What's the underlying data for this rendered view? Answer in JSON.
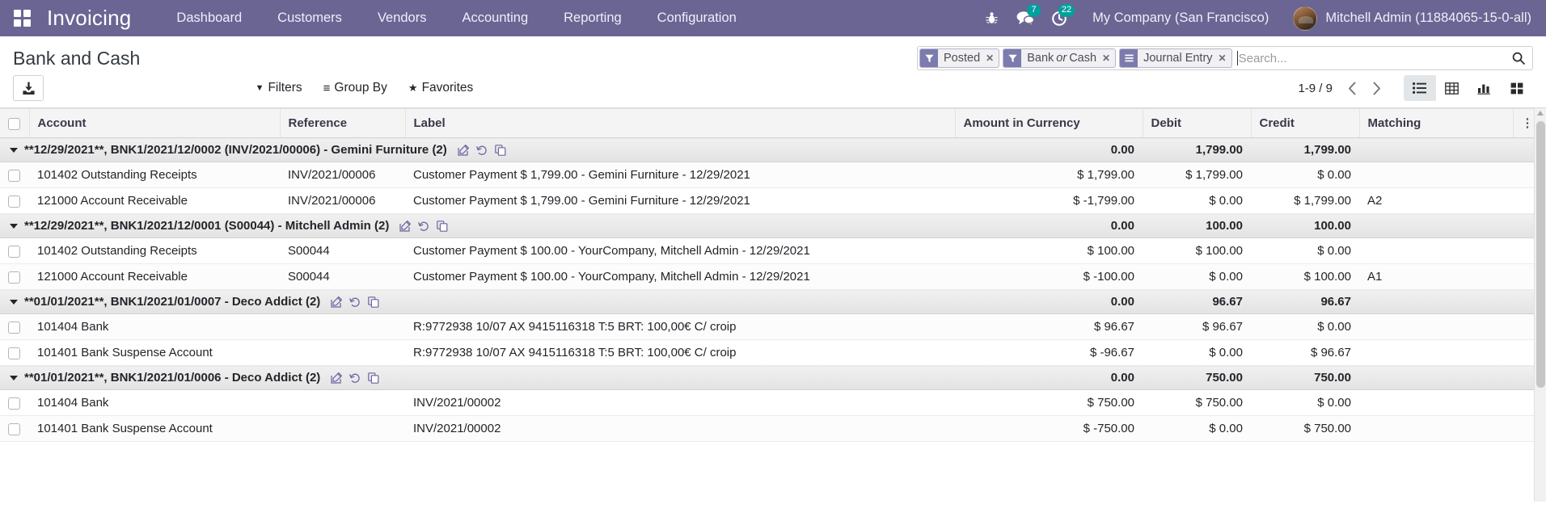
{
  "navbar": {
    "apps_icon": "apps-grid-icon",
    "brand": "Invoicing",
    "menu": [
      {
        "label": "Dashboard"
      },
      {
        "label": "Customers"
      },
      {
        "label": "Vendors"
      },
      {
        "label": "Accounting"
      },
      {
        "label": "Reporting"
      },
      {
        "label": "Configuration"
      }
    ],
    "sys_icons": [
      {
        "name": "bug-icon",
        "glyph": "☣",
        "badge": null
      },
      {
        "name": "messages-icon",
        "glyph": "💬",
        "badge": "7"
      },
      {
        "name": "activities-icon",
        "glyph": "◔",
        "badge": "22"
      }
    ],
    "company": "My Company (San Francisco)",
    "user": "Mitchell Admin (11884065-15-0-all)"
  },
  "control_panel": {
    "title": "Bank and Cash",
    "export_icon": "download-icon",
    "facets": [
      {
        "icon": "filter-icon",
        "label": "Posted",
        "remove": "✕"
      },
      {
        "icon": "filter-icon",
        "label_pre": "Bank ",
        "label_em": "or",
        "label_post": " Cash",
        "label": "Bank or Cash",
        "remove": "✕"
      },
      {
        "icon": "group-icon",
        "label": "Journal Entry",
        "remove": "✕"
      }
    ],
    "search_value": "",
    "search_placeholder": "Search...",
    "search_icon": "search-icon",
    "buttons": [
      {
        "name": "filters-dropdown",
        "icon": "filter-caret-icon",
        "glyph": "▼",
        "label": "Filters"
      },
      {
        "name": "groupby-dropdown",
        "icon": "hamburger-icon",
        "glyph": "≡",
        "label": "Group By"
      },
      {
        "name": "favorites-dropdown",
        "icon": "star-icon",
        "glyph": "★",
        "label": "Favorites"
      }
    ],
    "pager": "1-9 / 9",
    "prev_icon": "chevron-left-icon",
    "next_icon": "chevron-right-icon",
    "views": [
      {
        "name": "list-view-button",
        "icon": "list-icon",
        "active": true
      },
      {
        "name": "pivot-view-button",
        "icon": "table-icon",
        "active": false
      },
      {
        "name": "graph-view-button",
        "icon": "bar-chart-icon",
        "active": false
      },
      {
        "name": "kanban-view-button",
        "icon": "kanban-icon",
        "active": false
      }
    ]
  },
  "table": {
    "columns": [
      "Account",
      "Reference",
      "Label",
      "Amount in Currency",
      "Debit",
      "Credit",
      "Matching"
    ],
    "optional_icon": "vertical-dots-icon",
    "group_actions": [
      "edit-icon",
      "revert-icon",
      "duplicate-icon"
    ],
    "groups": [
      {
        "title": "**12/29/2021**, BNK1/2021/12/0002 (INV/2021/00006) - Gemini Furniture (2)",
        "amount": "0.00",
        "debit": "1,799.00",
        "credit": "1,799.00",
        "rows": [
          {
            "account": "101402 Outstanding Receipts",
            "reference": "INV/2021/00006",
            "label": "Customer Payment $ 1,799.00 - Gemini Furniture - 12/29/2021",
            "amount": "$ 1,799.00",
            "debit": "$ 1,799.00",
            "credit": "$ 0.00",
            "matching": ""
          },
          {
            "account": "121000 Account Receivable",
            "reference": "INV/2021/00006",
            "label": "Customer Payment $ 1,799.00 - Gemini Furniture - 12/29/2021",
            "amount": "$ -1,799.00",
            "debit": "$ 0.00",
            "credit": "$ 1,799.00",
            "matching": "A2"
          }
        ]
      },
      {
        "title": "**12/29/2021**, BNK1/2021/12/0001 (S00044) - Mitchell Admin (2)",
        "amount": "0.00",
        "debit": "100.00",
        "credit": "100.00",
        "rows": [
          {
            "account": "101402 Outstanding Receipts",
            "reference": "S00044",
            "label": "Customer Payment $ 100.00 - YourCompany, Mitchell Admin - 12/29/2021",
            "amount": "$ 100.00",
            "debit": "$ 100.00",
            "credit": "$ 0.00",
            "matching": ""
          },
          {
            "account": "121000 Account Receivable",
            "reference": "S00044",
            "label": "Customer Payment $ 100.00 - YourCompany, Mitchell Admin - 12/29/2021",
            "amount": "$ -100.00",
            "debit": "$ 0.00",
            "credit": "$ 100.00",
            "matching": "A1"
          }
        ]
      },
      {
        "title": "**01/01/2021**, BNK1/2021/01/0007 - Deco Addict (2)",
        "amount": "0.00",
        "debit": "96.67",
        "credit": "96.67",
        "rows": [
          {
            "account": "101404 Bank",
            "reference": "",
            "label": "R:9772938 10/07 AX 9415116318 T:5 BRT: 100,00€ C/ croip",
            "amount": "$ 96.67",
            "debit": "$ 96.67",
            "credit": "$ 0.00",
            "matching": ""
          },
          {
            "account": "101401 Bank Suspense Account",
            "reference": "",
            "label": "R:9772938 10/07 AX 9415116318 T:5 BRT: 100,00€ C/ croip",
            "amount": "$ -96.67",
            "debit": "$ 0.00",
            "credit": "$ 96.67",
            "matching": ""
          }
        ]
      },
      {
        "title": "**01/01/2021**, BNK1/2021/01/0006 - Deco Addict (2)",
        "amount": "0.00",
        "debit": "750.00",
        "credit": "750.00",
        "rows": [
          {
            "account": "101404 Bank",
            "reference": "",
            "label": "INV/2021/00002",
            "amount": "$ 750.00",
            "debit": "$ 750.00",
            "credit": "$ 0.00",
            "matching": ""
          },
          {
            "account": "101401 Bank Suspense Account",
            "reference": "",
            "label": "INV/2021/00002",
            "amount": "$ -750.00",
            "debit": "$ 0.00",
            "credit": "$ 750.00",
            "matching": ""
          }
        ]
      }
    ]
  },
  "colors": {
    "brand_purple": "#6b6594",
    "facet_purple": "#7c7bad",
    "badge_teal": "#00a09d"
  }
}
